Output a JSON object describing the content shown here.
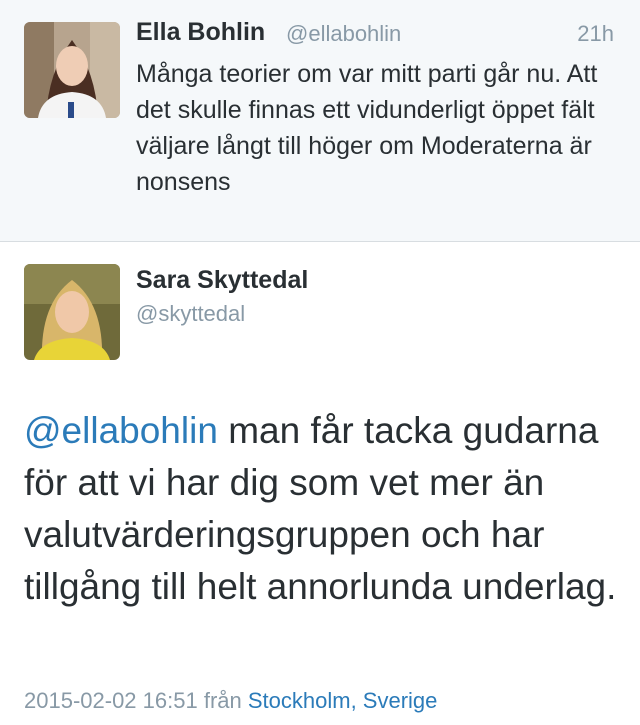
{
  "reply_to": {
    "name": "Ella Bohlin",
    "handle": "@ellabohlin",
    "time": "21h",
    "text": "Många teorier om var mitt parti går nu. Att det skulle finnas ett vidunderligt öppet fält väljare långt till höger om Moderaterna är nonsens"
  },
  "tweet": {
    "name": "Sara Skyttedal",
    "handle": "@skyttedal",
    "mention": "@ellabohlin",
    "text": " man får tacka gudarna för att vi har dig som vet mer än valutvärderingsgruppen och har tillgång till helt annorlunda underlag.",
    "timestamp": "2015-02-02 16:51",
    "from_label": "från",
    "place": "Stockholm, Sverige"
  },
  "colors": {
    "link": "#2b7bb9",
    "muted": "#8899a6",
    "text": "#292f33",
    "top_background": "#f5f8fa"
  }
}
